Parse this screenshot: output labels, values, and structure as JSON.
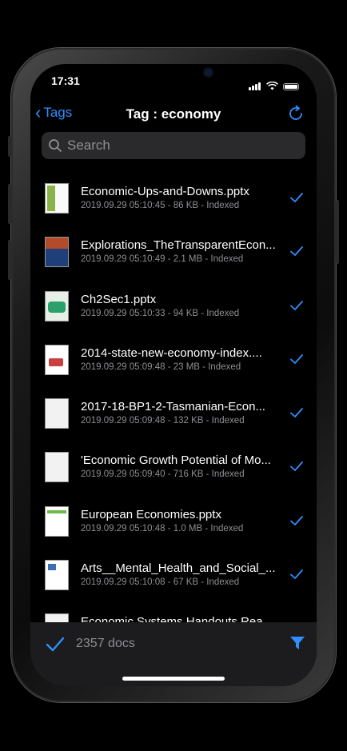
{
  "status": {
    "time": "17:31"
  },
  "nav": {
    "back_label": "Tags",
    "title": "Tag : economy"
  },
  "search": {
    "placeholder": "Search"
  },
  "files": [
    {
      "name": "Economic-Ups-and-Downs.pptx",
      "meta": "2019.09.29 05:10:45 - 86 KB -  Indexed"
    },
    {
      "name": "Explorations_TheTransparentEcon...",
      "meta": "2019.09.29 05:10:49 - 2.1 MB -  Indexed"
    },
    {
      "name": "Ch2Sec1.pptx",
      "meta": "2019.09.29 05:10:33 - 94 KB -  Indexed"
    },
    {
      "name": "2014-state-new-economy-index....",
      "meta": "2019.09.29 05:09:48 - 23 MB -  Indexed"
    },
    {
      "name": "2017-18-BP1-2-Tasmanian-Econ...",
      "meta": "2019.09.29 05:09:48 - 132 KB -  Indexed"
    },
    {
      "name": "'Economic Growth Potential of Mo...",
      "meta": "2019.09.29 05:09:40 - 716 KB -  Indexed"
    },
    {
      "name": "European Economies.pptx",
      "meta": "2019.09.29 05:10:48 - 1.0 MB -  Indexed"
    },
    {
      "name": "Arts__Mental_Health_and_Social_...",
      "meta": "2019.09.29 05:10:08 - 67 KB -  Indexed"
    },
    {
      "name": "Economic Systems Handouts Rea...",
      "meta": ""
    }
  ],
  "toolbar": {
    "doc_count": "2357 docs"
  },
  "colors": {
    "accent": "#2f8fff",
    "secondary_text": "#8e8e93",
    "toolbar_bg": "#1c1c1e"
  }
}
